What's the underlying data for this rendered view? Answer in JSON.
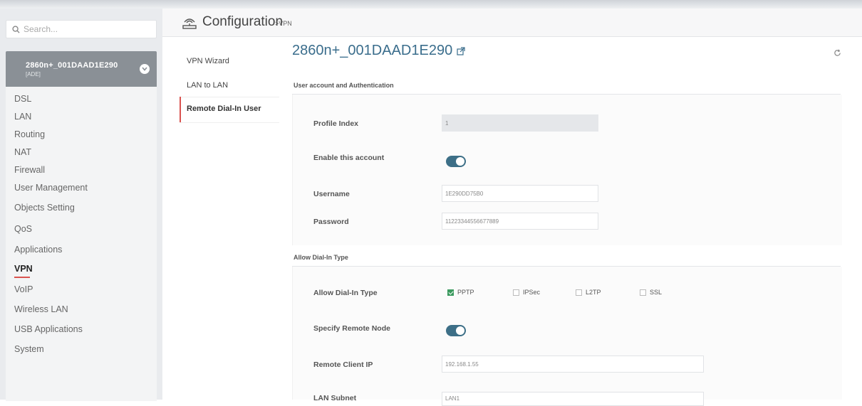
{
  "search": {
    "placeholder": "Search..."
  },
  "device": {
    "name": "2860n+_001DAAD1E290",
    "sub": "[ADE]"
  },
  "menu": {
    "items": [
      {
        "label": "DSL"
      },
      {
        "label": "LAN"
      },
      {
        "label": "Routing"
      },
      {
        "label": "NAT"
      },
      {
        "label": "Firewall"
      },
      {
        "label": "User Management"
      },
      {
        "label": "Objects Setting"
      },
      {
        "label": "QoS"
      },
      {
        "label": "Applications"
      },
      {
        "label": "VPN"
      },
      {
        "label": "VoIP"
      },
      {
        "label": "Wireless LAN"
      },
      {
        "label": "USB Applications"
      },
      {
        "label": "System"
      }
    ],
    "active": "VPN"
  },
  "header": {
    "title": "Configuration",
    "crumb": ">VPN"
  },
  "subnav": {
    "items": [
      {
        "label": "VPN Wizard"
      },
      {
        "label": "LAN to LAN"
      },
      {
        "label": "Remote Dial-In User"
      }
    ],
    "active": "Remote Dial-In User"
  },
  "main": {
    "title": "2860n+_001DAAD1E290",
    "section1": "User account and Authentication",
    "section2": "Allow Dial-In Type",
    "fields": {
      "profile_index": {
        "label": "Profile Index",
        "value": "1"
      },
      "enable_account": {
        "label": "Enable this account",
        "on": true
      },
      "username": {
        "label": "Username",
        "value": "1E290DD75B0"
      },
      "password": {
        "label": "Password",
        "value": "11223344556677889"
      },
      "dialin_type": {
        "label": "Allow Dial-In Type",
        "options": [
          {
            "label": "PPTP",
            "checked": true
          },
          {
            "label": "IPSec",
            "checked": false
          },
          {
            "label": "L2TP",
            "checked": false
          },
          {
            "label": "SSL",
            "checked": false
          }
        ]
      },
      "remote_node": {
        "label": "Specify Remote Node",
        "on": true
      },
      "remote_ip": {
        "label": "Remote Client IP",
        "value": "192.168.1.55"
      },
      "lan_subnet": {
        "label": "LAN Subnet",
        "value": "LAN1"
      }
    }
  },
  "colors": {
    "accent": "#3d6f87",
    "active_marker": "#d9534f",
    "checkbox": "#3c9a5f"
  }
}
